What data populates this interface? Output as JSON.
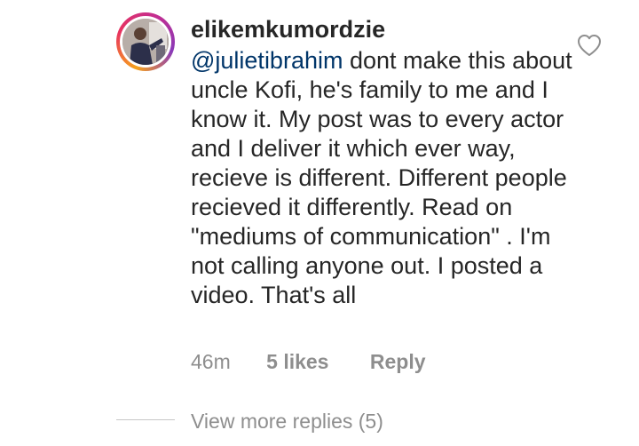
{
  "comment": {
    "username": "elikemkumordzie",
    "mention": "@julietibrahim",
    "body": " dont make this about uncle Kofi, he's family to me and I know it. My post was to every actor and I deliver it which ever way, recieve is different. Different people recieved it differently. Read on \"mediums of communication\" . I'm not calling anyone out. I posted a video. That's all",
    "time": "46m",
    "likes": "5 likes",
    "reply_label": "Reply",
    "like_icon": "heart-outline-icon"
  },
  "replies": {
    "view_more_label": "View more replies (5)"
  },
  "colors": {
    "text": "#262626",
    "mention": "#003569",
    "meta": "#8e8e8e",
    "avatar_ring_start": "#f7a21b",
    "avatar_ring_end": "#c42d8f"
  }
}
